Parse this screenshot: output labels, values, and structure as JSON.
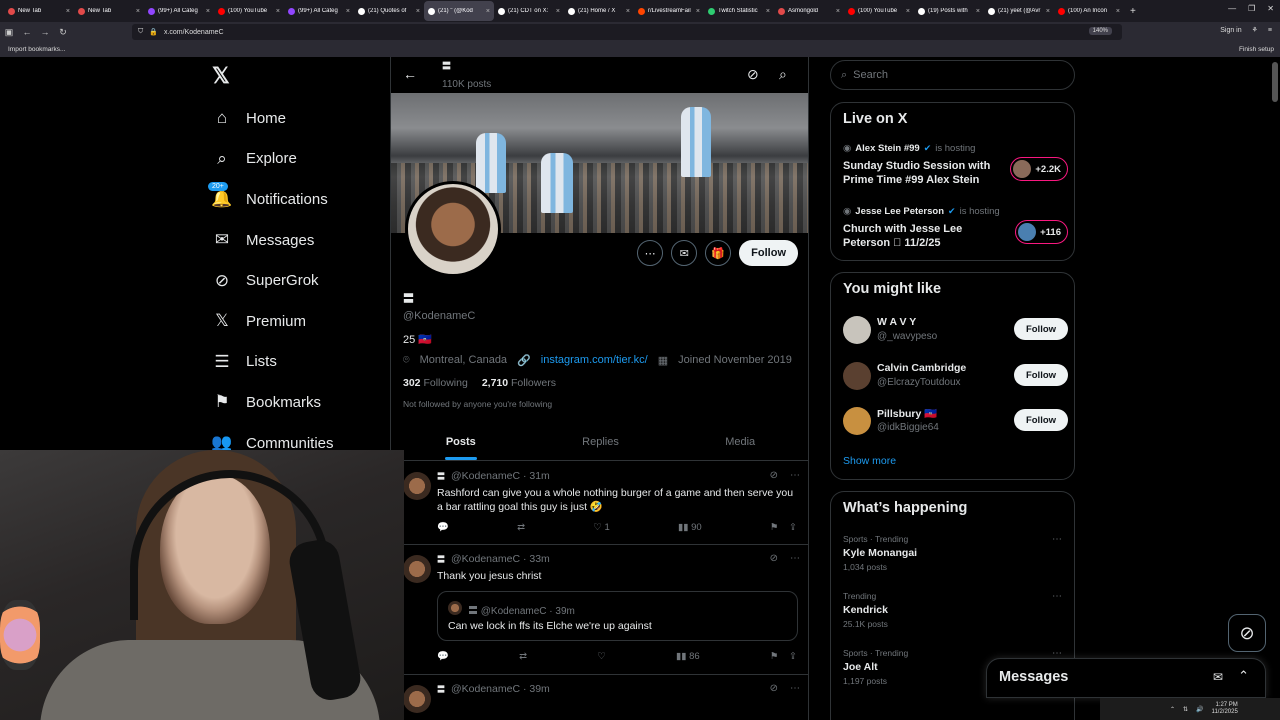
{
  "browser": {
    "tabs": [
      {
        "label": "New Tab",
        "color": "#e24a4a",
        "active": false
      },
      {
        "label": "New Tab",
        "color": "#e24a4a",
        "active": false
      },
      {
        "label": "(99+) All Categ",
        "color": "#9146ff",
        "active": false
      },
      {
        "label": "(100) YouTube",
        "color": "#ff0000",
        "active": false
      },
      {
        "label": "(99+) All Categ",
        "color": "#9146ff",
        "active": false
      },
      {
        "label": "(21) Quotes of",
        "color": "#ffffff",
        "active": false
      },
      {
        "label": "(21) \" (@Kod",
        "color": "#ffffff",
        "active": true
      },
      {
        "label": "(21) CDT on X:",
        "color": "#ffffff",
        "active": false
      },
      {
        "label": "(21) Home / X",
        "color": "#ffffff",
        "active": false
      },
      {
        "label": "r/LivestreamFail",
        "color": "#ff4500",
        "active": false
      },
      {
        "label": "Twitch Statistic",
        "color": "#2ecc71",
        "active": false
      },
      {
        "label": "Asmongold",
        "color": "#e24a4a",
        "active": false
      },
      {
        "label": "(100) YouTube",
        "color": "#ff0000",
        "active": false
      },
      {
        "label": "(19) Posts with",
        "color": "#ffffff",
        "active": false
      },
      {
        "label": "(21) yeet (@Avr",
        "color": "#ffffff",
        "active": false
      },
      {
        "label": "(100) An Incon",
        "color": "#ff0000",
        "active": false
      }
    ],
    "url": "x.com/KodenameC",
    "zoom": "140%",
    "sign_in": "Sign in",
    "import_bookmarks": "Import bookmarks...",
    "finish_setup": "Finish setup"
  },
  "nav": {
    "items": [
      {
        "label": "Home",
        "icon": "home-icon",
        "glyph": "⌂"
      },
      {
        "label": "Explore",
        "icon": "search-icon",
        "glyph": "⌕"
      },
      {
        "label": "Notifications",
        "icon": "bell-icon",
        "glyph": "🔔"
      },
      {
        "label": "Messages",
        "icon": "mail-icon",
        "glyph": "✉"
      },
      {
        "label": "SuperGrok",
        "icon": "grok-icon",
        "glyph": "⊘"
      },
      {
        "label": "Premium",
        "icon": "x-logo-icon",
        "glyph": "𝕏"
      },
      {
        "label": "Lists",
        "icon": "list-icon",
        "glyph": "☰"
      },
      {
        "label": "Bookmarks",
        "icon": "bookmark-icon",
        "glyph": "⚑"
      },
      {
        "label": "Communities",
        "icon": "people-icon",
        "glyph": "👥"
      }
    ],
    "notif_badge": "20+"
  },
  "profile": {
    "header_name": "〓",
    "post_count": "110K posts",
    "display_name": "〓",
    "handle": "@KodenameC",
    "bio": "25 🇭🇹",
    "location": "Montreal, Canada",
    "link": "instagram.com/tier.kc/",
    "joined": "Joined November 2019",
    "following_count": "302",
    "following_label": "Following",
    "followers_count": "2,710",
    "followers_label": "Followers",
    "not_followed": "Not followed by anyone you're following",
    "follow_label": "Follow",
    "tabs": [
      "Posts",
      "Replies",
      "Media"
    ]
  },
  "tweets": [
    {
      "handle": "@KodenameC",
      "time": "31m",
      "text": "Rashford can give you a whole nothing burger of a game and then serve you a bar rattling goal this guy is just 🤣",
      "likes": "1",
      "views": "90"
    },
    {
      "handle": "@KodenameC",
      "time": "33m",
      "text": "Thank you jesus christ",
      "likes": "",
      "views": "86",
      "quote": {
        "handle": "@KodenameC",
        "time": "39m",
        "text": "Can we lock in ffs its Elche we're up against"
      }
    },
    {
      "handle": "@KodenameC",
      "time": "39m",
      "text": "",
      "likes": "",
      "views": ""
    }
  ],
  "right": {
    "search_placeholder": "Search",
    "live_title": "Live on X",
    "live": [
      {
        "host": "Alex Stein #99",
        "status": "is hosting",
        "title": "Sunday Studio Session with Prime Time #99 Alex Stein",
        "count": "+2.2K"
      },
      {
        "host": "Jesse Lee Peterson",
        "status": "is hosting",
        "title": "Church with Jesse Lee Peterson 🏽 11/2/25",
        "count": "+116"
      }
    ],
    "wtf_title": "You might like",
    "wtf": [
      {
        "name": "W A V Y",
        "handle": "@_wavypeso",
        "avatar": "#c8c4bc"
      },
      {
        "name": "Calvin Cambridge",
        "handle": "@ElcrazyToutdoux",
        "avatar": "#5a4030"
      },
      {
        "name": "Pillsbury 🇭🇹",
        "handle": "@idkBiggie64",
        "avatar": "#c89040"
      }
    ],
    "show_more": "Show more",
    "happening_title": "What’s happening",
    "trends": [
      {
        "category": "Sports · Trending",
        "title": "Kyle Monangai",
        "count": "1,034 posts"
      },
      {
        "category": "Trending",
        "title": "Kendrick",
        "count": "25.1K posts"
      },
      {
        "category": "Sports · Trending",
        "title": "Joe Alt",
        "count": "1,197 posts"
      }
    ],
    "messages": "Messages"
  },
  "taskbar": {
    "time": "1:27 PM",
    "date": "11/2/2025"
  }
}
